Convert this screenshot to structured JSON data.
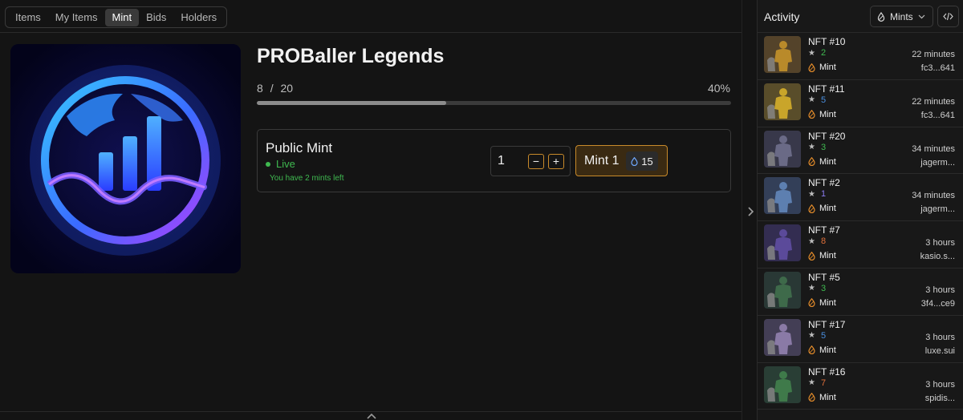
{
  "tabs": [
    {
      "label": "Items",
      "active": false
    },
    {
      "label": "My Items",
      "active": false
    },
    {
      "label": "Mint",
      "active": true
    },
    {
      "label": "Bids",
      "active": false
    },
    {
      "label": "Holders",
      "active": false
    }
  ],
  "collection": {
    "title": "PROBaller Legends",
    "minted": "8",
    "separator": "/",
    "supply": "20",
    "percent_label": "40%",
    "progress_fraction": 0.4
  },
  "mint_card": {
    "phase": "Public Mint",
    "status": "Live",
    "mints_left_note": "You have 2 mints left",
    "quantity": "1",
    "minus": "−",
    "plus": "+",
    "mint_button_label": "Mint 1",
    "price": "15"
  },
  "activity": {
    "title": "Activity",
    "filter_label": "Mints",
    "rows": [
      {
        "name": "NFT #10",
        "rank": "2",
        "rank_color": "#3fb950",
        "event": "Mint",
        "time": "22 minutes",
        "address": "fc3...641",
        "thumb": "#b98a2a"
      },
      {
        "name": "NFT #11",
        "rank": "5",
        "rank_color": "#4a8fe0",
        "event": "Mint",
        "time": "22 minutes",
        "address": "fc3...641",
        "thumb": "#c9a52a"
      },
      {
        "name": "NFT #20",
        "rank": "3",
        "rank_color": "#3fb950",
        "event": "Mint",
        "time": "34 minutes",
        "address": "jagerm...",
        "thumb": "#6a6a86"
      },
      {
        "name": "NFT #2",
        "rank": "1",
        "rank_color": "#8b7cf0",
        "event": "Mint",
        "time": "34 minutes",
        "address": "jagerm...",
        "thumb": "#5d7fb0"
      },
      {
        "name": "NFT #7",
        "rank": "8",
        "rank_color": "#e0703a",
        "event": "Mint",
        "time": "3 hours",
        "address": "kasio.s...",
        "thumb": "#5b4a9a"
      },
      {
        "name": "NFT #5",
        "rank": "3",
        "rank_color": "#3fb950",
        "event": "Mint",
        "time": "3 hours",
        "address": "3f4...ce9",
        "thumb": "#3e6a4a"
      },
      {
        "name": "NFT #17",
        "rank": "5",
        "rank_color": "#4a8fe0",
        "event": "Mint",
        "time": "3 hours",
        "address": "luxe.sui",
        "thumb": "#8a7aa6"
      },
      {
        "name": "NFT #16",
        "rank": "7",
        "rank_color": "#e0703a",
        "event": "Mint",
        "time": "3 hours",
        "address": "spidis...",
        "thumb": "#3f7a4a"
      }
    ]
  },
  "colors": {
    "accent_orange": "#c88a2a",
    "live_green": "#3fb950"
  }
}
